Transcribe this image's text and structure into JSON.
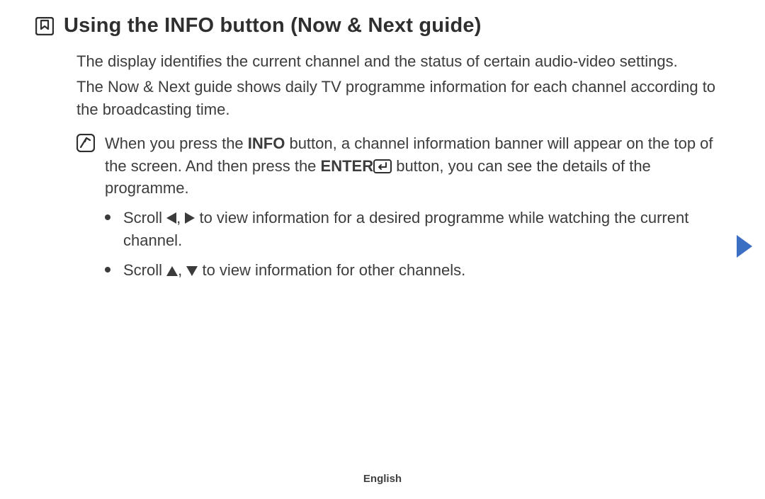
{
  "heading": "Using the INFO button (Now & Next guide)",
  "para1": "The display identifies the current channel and the status of certain audio-video settings.",
  "para2": "The Now & Next guide shows daily TV programme information for each channel according to the broadcasting time.",
  "note": {
    "pre": "When you press the ",
    "info": "INFO",
    "mid": " button, a channel information banner will appear on the top of the screen. And then press the ",
    "enter": "ENTER",
    "post": " button, you can see the details of the programme."
  },
  "bullet1": {
    "pre": "Scroll ",
    "sep": ", ",
    "post": " to view information for a desired programme while watching the current channel."
  },
  "bullet2": {
    "pre": "Scroll ",
    "sep": ", ",
    "post": " to view information for other channels."
  },
  "footer": "English"
}
